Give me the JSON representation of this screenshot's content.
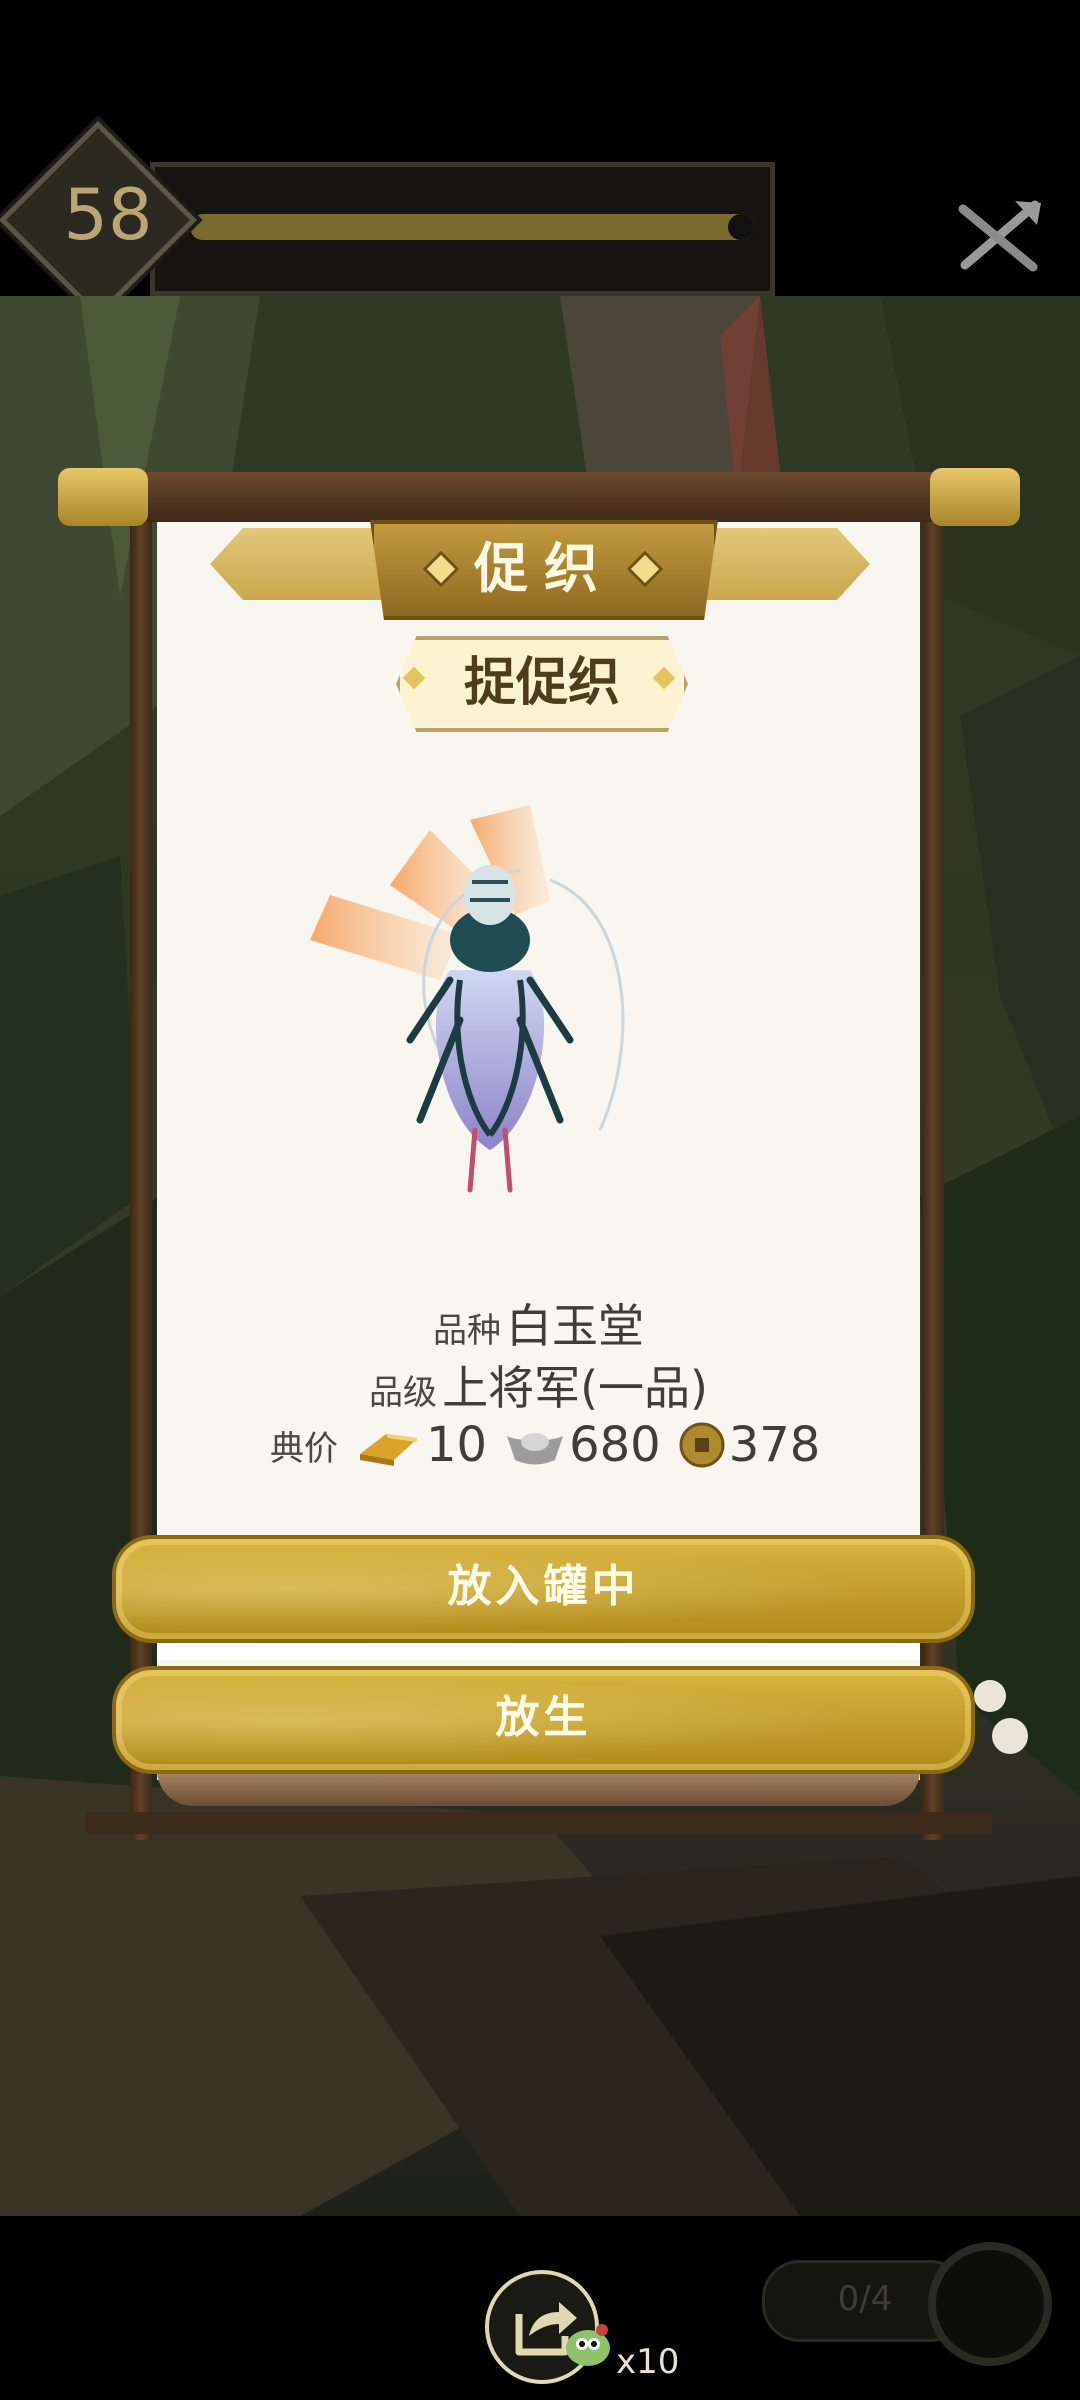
{
  "level": {
    "value": "58",
    "xp_fraction": 0.96
  },
  "panel": {
    "banner_title": "促织",
    "subtitle": "捉促织",
    "breed_label": "品种",
    "breed_value": "白玉堂",
    "grade_label": "品级",
    "grade_value": "上将军(一品)",
    "price_label": "典价",
    "price_gold": "10",
    "price_silver": "680",
    "price_copper": "378"
  },
  "buttons": {
    "put_in_jar": "放入罐中",
    "release": "放生"
  },
  "bottom": {
    "pet_count": "x10",
    "progress": "0/4"
  },
  "icons": [
    "close-icon",
    "gold-ingot-icon",
    "silver-ingot-icon",
    "copper-coin-icon",
    "share-icon",
    "pet-icon"
  ]
}
